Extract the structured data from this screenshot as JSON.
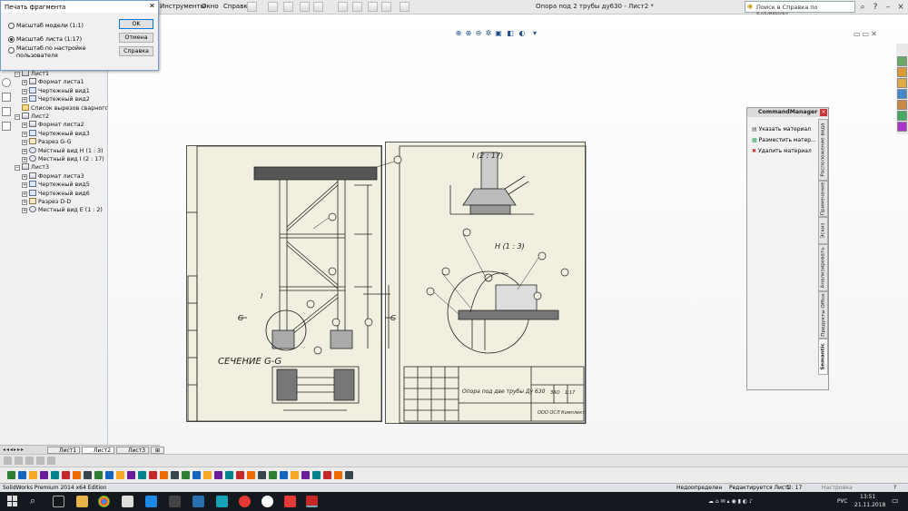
{
  "app": {
    "document_title": "Опора под 2 трубы ду630 - Лист2 *",
    "search_placeholder": "Поиск в Справка по SolidWorks",
    "menus": [
      "Инструменты",
      "Окно",
      "Справка"
    ]
  },
  "dialog": {
    "title": "Печать фрагмента",
    "options": [
      {
        "label": "Масштаб модели (1:1)",
        "checked": false
      },
      {
        "label": "Масштаб листа (1:17)",
        "checked": true
      },
      {
        "label": "Масштаб по настройке пользователя",
        "checked": false
      }
    ],
    "buttons": {
      "ok": "OK",
      "cancel": "Отмена",
      "help": "Справка"
    }
  },
  "tree": {
    "items": [
      {
        "label": "Лист1",
        "level": 0,
        "icon": "sheet",
        "expander": "−"
      },
      {
        "label": "Формат листа1",
        "level": 1,
        "icon": "sheet",
        "expander": "+"
      },
      {
        "label": "Чертежный вид1",
        "level": 1,
        "icon": "view",
        "expander": "+"
      },
      {
        "label": "Чертежный вид2",
        "level": 1,
        "icon": "view",
        "expander": "+"
      },
      {
        "label": "Список вырезов сварного изд",
        "level": 1,
        "icon": "folder",
        "expander": ""
      },
      {
        "label": "Лист2",
        "level": 0,
        "icon": "sheet",
        "expander": "−"
      },
      {
        "label": "Формат листа2",
        "level": 1,
        "icon": "sheet",
        "expander": "+"
      },
      {
        "label": "Чертежный вид3",
        "level": 1,
        "icon": "view",
        "expander": "+"
      },
      {
        "label": "Разрез G-G",
        "level": 1,
        "icon": "section",
        "expander": "+"
      },
      {
        "label": "Местный вид H (1 : 3)",
        "level": 1,
        "icon": "detail",
        "expander": "+"
      },
      {
        "label": "Местный вид I (2 : 17)",
        "level": 1,
        "icon": "detail",
        "expander": "+"
      },
      {
        "label": "Лист3",
        "level": 0,
        "icon": "sheet",
        "expander": "−"
      },
      {
        "label": "Формат листа3",
        "level": 1,
        "icon": "sheet",
        "expander": "+"
      },
      {
        "label": "Чертежный вид5",
        "level": 1,
        "icon": "view",
        "expander": "+"
      },
      {
        "label": "Чертежный вид6",
        "level": 1,
        "icon": "view",
        "expander": "+"
      },
      {
        "label": "Разрез D-D",
        "level": 1,
        "icon": "section",
        "expander": "+"
      },
      {
        "label": "Местный вид E (1 : 2)",
        "level": 1,
        "icon": "detail",
        "expander": "+"
      }
    ]
  },
  "drawing": {
    "section_label": "СЕЧЕНИЕ G-G",
    "detail_i_label": "I (2 : 17)",
    "detail_h_label": "H (1 : 3)",
    "marker_i": "I",
    "marker_g_left": "G",
    "marker_g_right": "G",
    "title_block_name": "Опора под две трубы Ду 630",
    "title_block_code": "ЗАО",
    "title_block_sheet": "1:17",
    "title_block_company": "ООО ОСЛ Комплект"
  },
  "command_manager": {
    "title": "CommandManager",
    "items": [
      "Указать материал",
      "Разместить матер...",
      "Удалить материал"
    ],
    "tabs": [
      "Расположение вида",
      "Примечание",
      "Эскиз",
      "Анализировать",
      "Продукты Office",
      "Semantic"
    ]
  },
  "sheet_tabs": [
    "Лист1",
    "Лист2",
    "Лист3"
  ],
  "active_sheet_tab": "Лист2",
  "status": {
    "edition": "SolidWorks Premium 2014 x64 Edition",
    "state": "Недоопределен",
    "editing": "Редактируется Лист2",
    "scale": "1 : 17",
    "settings": "Настройка"
  },
  "taskbar": {
    "lang": "РУС",
    "time": "13:51",
    "date": "21.11.2018"
  },
  "colors": {
    "sheet_bg": "#f1f0e0",
    "line": "#222222",
    "accent": "#0078d7",
    "taskbar": "#14181f"
  }
}
